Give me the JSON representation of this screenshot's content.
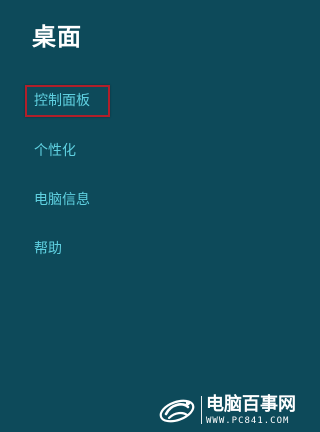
{
  "panel": {
    "title": "桌面",
    "items": [
      {
        "label": "控制面板",
        "highlighted": true
      },
      {
        "label": "个性化",
        "highlighted": false
      },
      {
        "label": "电脑信息",
        "highlighted": false
      },
      {
        "label": "帮助",
        "highlighted": false
      }
    ]
  },
  "watermark": {
    "site_name": "电脑百事网",
    "url": "WWW.PC841.COM",
    "logo_icon": "pc841-logo-icon"
  },
  "colors": {
    "background": "#0d4a5a",
    "title": "#ffffff",
    "link": "#5fd0e0",
    "highlight": "#b11f2a"
  }
}
